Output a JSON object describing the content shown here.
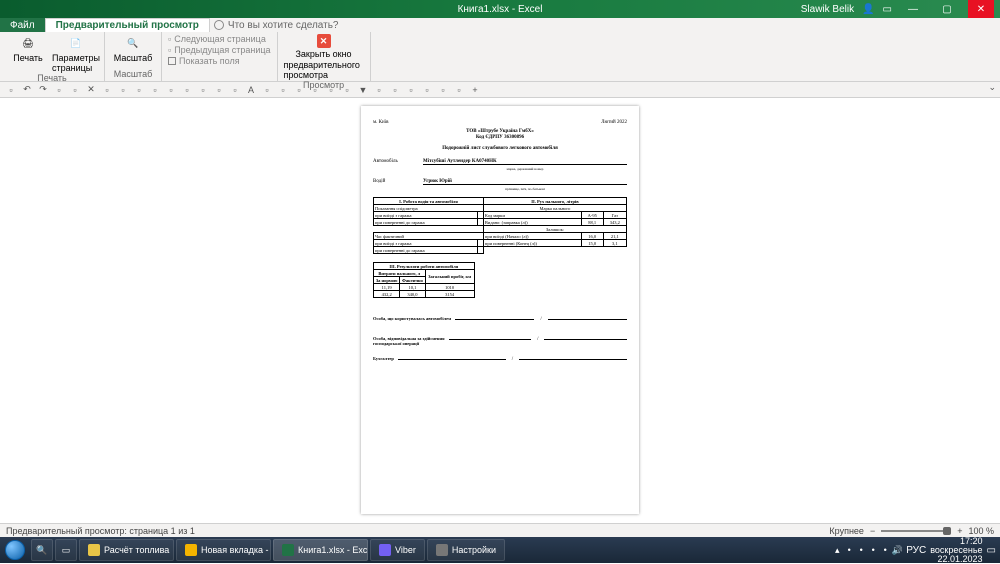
{
  "titlebar": {
    "title": "Книга1.xlsx - Excel",
    "user": "Slawik Belik"
  },
  "tabs": {
    "file": "Файл",
    "active": "Предварительный просмотр",
    "tellme": "Что вы хотите сделать?"
  },
  "ribbon": {
    "print": {
      "label": "Печать",
      "btn": "Печать"
    },
    "page_setup": {
      "btn": "Параметры страницы"
    },
    "zoom": {
      "label": "Масштаб",
      "btn": "Масштаб"
    },
    "next_page": "Следующая страница",
    "prev_page": "Предыдущая страница",
    "show_margins": "Показать поля",
    "close": {
      "top": "Закрыть окно",
      "bottom": "предварительного просмотра"
    },
    "view_label": "Просмотр"
  },
  "page": {
    "city": "м. Київ",
    "month": "Лютий 2022",
    "company": "ТОВ «Штрубе Україна ГмбХ»",
    "code": "Код ЄДРПУ 36300896",
    "doc_title": "Подорожній лист службового легкового автомобіля",
    "car_label": "Автомобіль",
    "car_value": "Мітсубіші Аутлендер КА0740НК",
    "car_sub": "марка, державний номер",
    "driver_label": "Водій",
    "driver_value": "Угрюк Юрій",
    "driver_sub": "прізвище, ім'я, по-батькові",
    "t1": {
      "h1": "І. Робота водія та автомобіля",
      "h2": "ІІ. Рух пального, літрів",
      "r1": "Показання спідометра",
      "r2": "Марка пального",
      "r3a": "при виїзді з гаража",
      "r3b": "Код марки",
      "r3c": "А-95",
      "r3d": "Газ",
      "r4a": "при поверненні до гаража",
      "r4b": "Видано: (заправка (л))",
      "r4c": "88,1",
      "r4d": "343,2",
      "r5": "Залишок:",
      "r6a": "Час фактичний",
      "r6b": "при виїзді (Начало (л))",
      "r6c": "16,0",
      "r6d": "21,1",
      "r7a": "при виїзді з гаража",
      "r7b": "при поверненні (Конец (л))",
      "r7c": "15,0",
      "r7d": "3,1",
      "r8": "при поверненні до гаража"
    },
    "t2": {
      "title": "ІІІ. Результати роботи автомобіля",
      "h1": "Витрати пального, л",
      "h2": "Загальний пробіг, км",
      "h1a": "За нормою",
      "h1b": "Фактично",
      "v1a": "11,19",
      "v1b": "10,1",
      "v1c": "1010",
      "v2a": "432,2",
      "v2b": "340,0",
      "v2c": "3154"
    },
    "sig1": "Особа, що користувалась автомобілем",
    "sig2a": "Особа, відповідальна за здійснення",
    "sig2b": "господарської операції",
    "sig3": "Бухгалтер"
  },
  "status": {
    "left": "Предварительный просмотр: страница 1 из 1",
    "larger": "Крупнее",
    "zoom": "100 %"
  },
  "taskbar": {
    "items": [
      "Расчёт топлива",
      "Новая вкладка - Go...",
      "Книга1.xlsx - Excel",
      "Viber",
      "Настройки"
    ],
    "lang": "РУС",
    "time": "17:20",
    "day": "воскресенье",
    "date": "22.01.2023"
  }
}
